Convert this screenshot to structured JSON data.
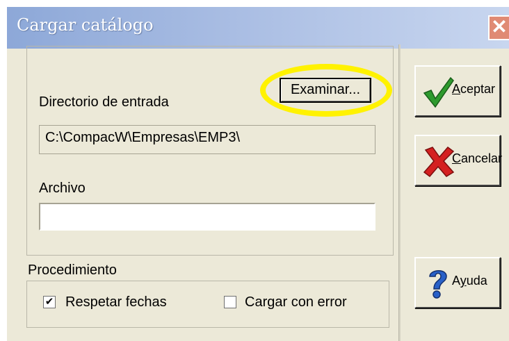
{
  "window": {
    "title": "Cargar catálogo",
    "close_glyph": "✕"
  },
  "directorio": {
    "label": "Directorio de entrada",
    "value": "C:\\CompacW\\Empresas\\EMP3\\",
    "browse_label": "Examinar..."
  },
  "archivo": {
    "label": "Archivo",
    "value": ""
  },
  "procedimiento": {
    "label": "Procedimiento",
    "options": [
      {
        "label": "Respetar fechas",
        "checked": true
      },
      {
        "label": "Cargar con error",
        "checked": false
      }
    ]
  },
  "buttons": {
    "aceptar": {
      "first": "A",
      "rest": "ceptar",
      "icon": "check-icon"
    },
    "cancelar": {
      "first": "C",
      "rest": "ancelar",
      "icon": "x-icon"
    },
    "ayuda": {
      "pre": "A",
      "underlined": "y",
      "post": "uda",
      "icon": "question-icon"
    }
  },
  "colors": {
    "highlight": "#fff200",
    "check_green": "#2e9a2e",
    "x_red": "#d42020",
    "help_blue": "#2860c8"
  }
}
